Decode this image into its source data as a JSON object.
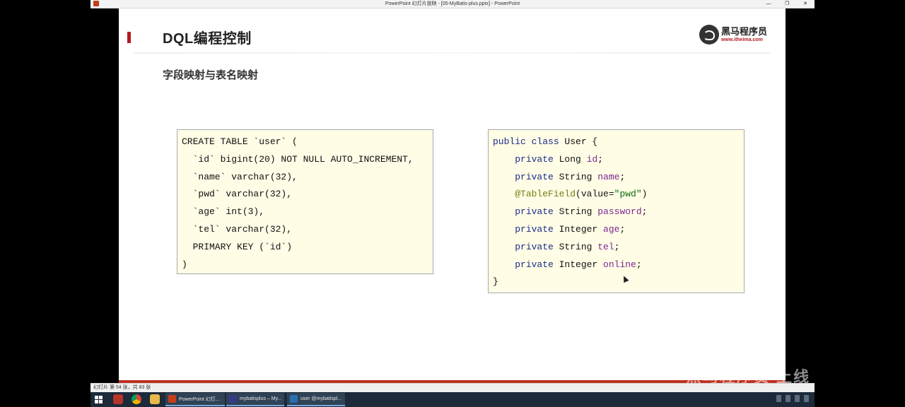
{
  "window": {
    "title": "PowerPoint 幻灯片放映 - [05-MyBatis-plus.pptx] - PowerPoint",
    "controls": [
      "—",
      "❐",
      "✕"
    ]
  },
  "slide": {
    "title": "DQL编程控制",
    "subtitle": "字段映射与表名映射",
    "logo": {
      "name": "黑马程序员",
      "url": "www.itheima.com"
    },
    "sql_code": [
      "CREATE TABLE `user` (",
      "  `id` bigint(20) NOT NULL AUTO_INCREMENT,",
      "  `name` varchar(32),",
      "  `pwd` varchar(32),",
      "  `age` int(3),",
      "  `tel` varchar(32),",
      "  PRIMARY KEY (`id`)",
      ")"
    ],
    "java_code": {
      "l1_kw": "public class",
      "l1_name": " User {",
      "indent": "    ",
      "private": "private",
      "l2_type": " Long ",
      "l2_field": "id",
      "l3_type": " String ",
      "l3_field": "name",
      "l4_ann": "@TableField",
      "l4_args_open": "(value=",
      "l4_str": "\"pwd\"",
      "l4_close": ")",
      "l5_type": " String ",
      "l5_field": "password",
      "l6_type": " Integer ",
      "l6_field": "age",
      "l7_type": " String ",
      "l7_field": "tel",
      "l8_type": " Integer ",
      "l8_field": "online",
      "semi": ";",
      "close": "}"
    },
    "watermark": "黑马程序员 上线"
  },
  "status": {
    "slide_info": "幻灯片 第 54 张，共 83 张"
  },
  "taskbar": {
    "apps": [
      {
        "label": "PowerPoint 幻灯...",
        "color": "#c43e1c"
      },
      {
        "label": "mybatisplus – My...",
        "color": "#3a3a8a"
      },
      {
        "label": "user @mybatispl...",
        "color": "#2a6fb0"
      }
    ],
    "pinned_icons": [
      "search-icon",
      "chrome-icon",
      "explorer-icon"
    ]
  }
}
